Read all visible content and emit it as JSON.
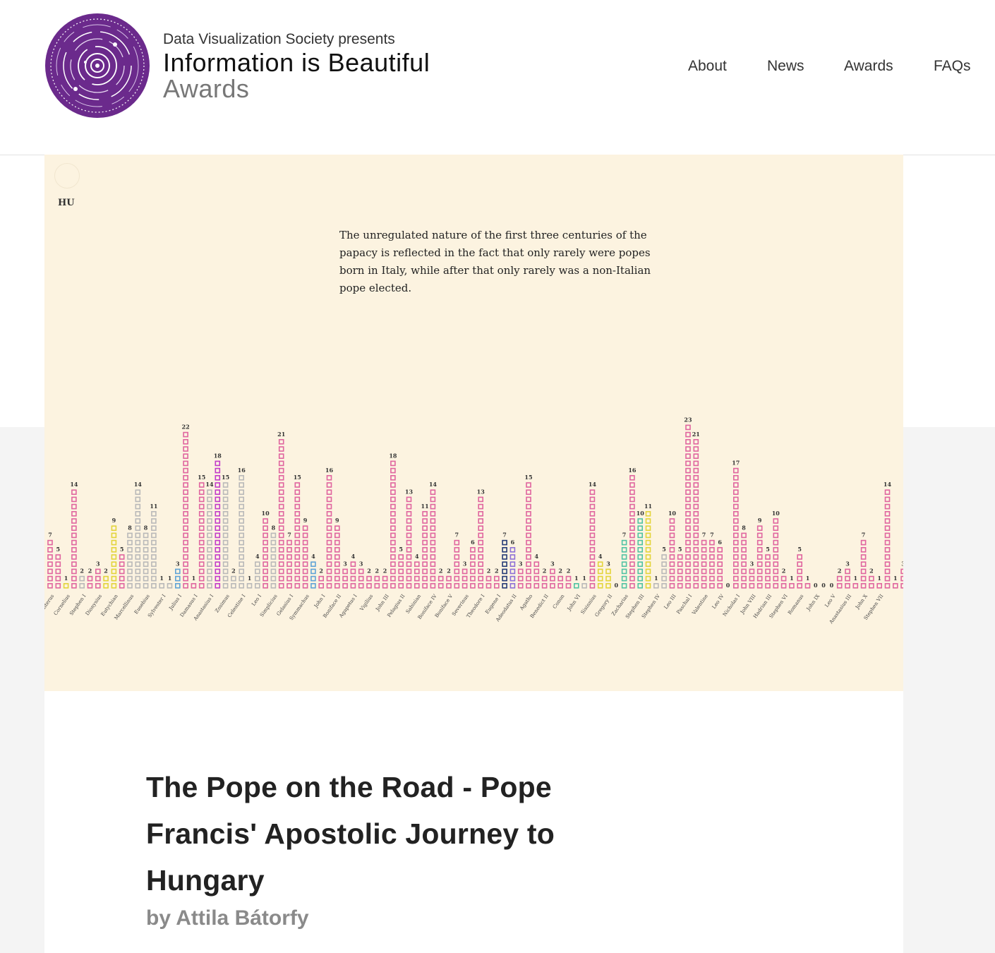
{
  "header": {
    "presents": "Data Visualization Society presents",
    "title": "Information is Beautiful",
    "subtitle": "Awards",
    "nav": [
      "About",
      "News",
      "Awards",
      "FAQs"
    ]
  },
  "colors": {
    "pink": "#e0659f",
    "gray": "#b9b9b9",
    "yellow": "#e3d43a",
    "blue": "#5fa3d6",
    "purple": "#c23bc9",
    "green": "#4fc3a3",
    "violet": "#8d6fd6",
    "navy": "#233a76",
    "background": "#fcf3e0"
  },
  "chart_panel": {
    "lang_label": "HU",
    "annotation": "The unregulated nature of the first three centuries of the papacy is reflected in the fact that only rarely were popes born in Italy, while after that only rarely was a non-Italian pope elected."
  },
  "chart_data": {
    "type": "bar",
    "unit_style": "stacked-squares",
    "values": [
      7,
      5,
      1,
      14,
      2,
      2,
      3,
      2,
      9,
      5,
      8,
      14,
      8,
      11,
      1,
      1,
      3,
      22,
      1,
      15,
      14,
      18,
      15,
      2,
      16,
      1,
      4,
      10,
      8,
      21,
      7,
      15,
      9,
      4,
      2,
      16,
      9,
      3,
      4,
      3,
      2,
      2,
      2,
      18,
      5,
      13,
      4,
      11,
      14,
      2,
      2,
      7,
      3,
      6,
      13,
      2,
      2,
      7,
      6,
      3,
      15,
      4,
      2,
      3,
      2,
      2,
      1,
      1,
      14,
      4,
      3,
      0,
      7,
      16,
      10,
      11,
      1,
      5,
      10,
      5,
      23,
      21,
      7,
      7,
      6,
      0,
      17,
      8,
      3,
      9,
      5,
      10,
      2,
      1,
      5,
      1,
      0,
      0,
      0,
      2,
      3,
      1,
      7,
      2,
      1,
      14,
      1,
      3
    ],
    "colors": [
      "pink",
      "pink",
      "yellow",
      "pink",
      "gray",
      "pink",
      "pink",
      "yellow",
      "yellow",
      "pink",
      "gray",
      "gray",
      "gray",
      "gray",
      "gray",
      "gray",
      "blue",
      "pink",
      "pink",
      "pink",
      "gray",
      "purple",
      "gray",
      "gray",
      "gray",
      "gray",
      "gray",
      "pink",
      "gray",
      "pink",
      "pink",
      "pink",
      "pink",
      "blue",
      "pink",
      "pink",
      "pink",
      "pink",
      "pink",
      "pink",
      "pink",
      "pink",
      "pink",
      "pink",
      "pink",
      "pink",
      "pink",
      "pink",
      "pink",
      "pink",
      "pink",
      "pink",
      "pink",
      "pink",
      "pink",
      "pink",
      "pink",
      "navy",
      "violet",
      "pink",
      "pink",
      "pink",
      "pink",
      "pink",
      "pink",
      "pink",
      "green",
      "gray",
      "pink",
      "yellow",
      "yellow",
      "pink",
      "green",
      "pink",
      "green",
      "yellow",
      "gray",
      "gray",
      "pink",
      "pink",
      "pink",
      "pink",
      "pink",
      "pink",
      "pink",
      "pink",
      "pink",
      "pink",
      "pink",
      "pink",
      "pink",
      "pink",
      "pink",
      "pink",
      "pink",
      "pink",
      "pink",
      "pink",
      "pink",
      "pink",
      "pink",
      "pink",
      "pink",
      "pink",
      "pink",
      "pink",
      "pink",
      "pink"
    ],
    "categories": [
      "Anterus",
      "Cornelius",
      "Stephen I",
      "Dionysius",
      "Eutychian",
      "Marcellinus",
      "Eusebius",
      "Sylvester I",
      "Julius I",
      "Damasus I",
      "Anastasius I",
      "Zosimus",
      "Celestine I",
      "Leo I",
      "Simplicius",
      "Gelasius I",
      "Symmachus",
      "John I",
      "Boniface II",
      "Agapetus I",
      "Vigilius",
      "John III",
      "Pelagius II",
      "Sabinian",
      "Boniface IV",
      "Boniface V",
      "Severinus",
      "Theodore I",
      "Eugene I",
      "Adeodatus II",
      "Agatho",
      "Benedict II",
      "Conon",
      "John VI",
      "Sisinnius",
      "Gregory II",
      "Zacharias",
      "Stephen III",
      "Stephen IV",
      "Leo III",
      "Paschal I",
      "Valentine",
      "Leo IV",
      "Nicholas I",
      "John VIII",
      "Hadrian III",
      "Stephen VI",
      "Romanus",
      "John IX",
      "Leo V",
      "Anastasius III",
      "John X",
      "Stephen VII"
    ]
  },
  "title": "The Pope on the Road - Pope Francis' Apostolic Journey to Hungary",
  "author": "by Attila Bátorfy"
}
